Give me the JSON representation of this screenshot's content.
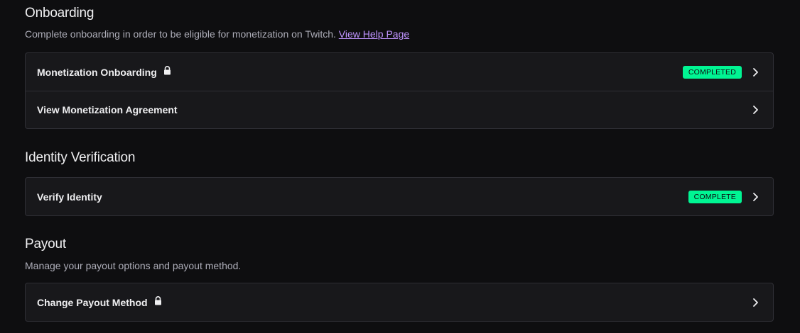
{
  "onboarding": {
    "title": "Onboarding",
    "description": "Complete onboarding in order to be eligible for monetization on Twitch.",
    "help_link": "View Help Page",
    "rows": [
      {
        "label": "Monetization Onboarding",
        "locked": true,
        "badge": "COMPLETED"
      },
      {
        "label": "View Monetization Agreement",
        "locked": false,
        "badge": ""
      }
    ]
  },
  "identity": {
    "title": "Identity Verification",
    "rows": [
      {
        "label": "Verify Identity",
        "locked": false,
        "badge": "COMPLETE"
      }
    ]
  },
  "payout": {
    "title": "Payout",
    "description": "Manage your payout options and payout method.",
    "rows": [
      {
        "label": "Change Payout Method",
        "locked": true,
        "badge": ""
      }
    ]
  },
  "colors": {
    "background": "#0e0e10",
    "card": "#18181b",
    "border": "#2f2f35",
    "accent_link": "#bf94ff",
    "badge_green": "#00f593"
  },
  "icons": {
    "lock": "lock-icon",
    "chevron": "chevron-right-icon"
  }
}
